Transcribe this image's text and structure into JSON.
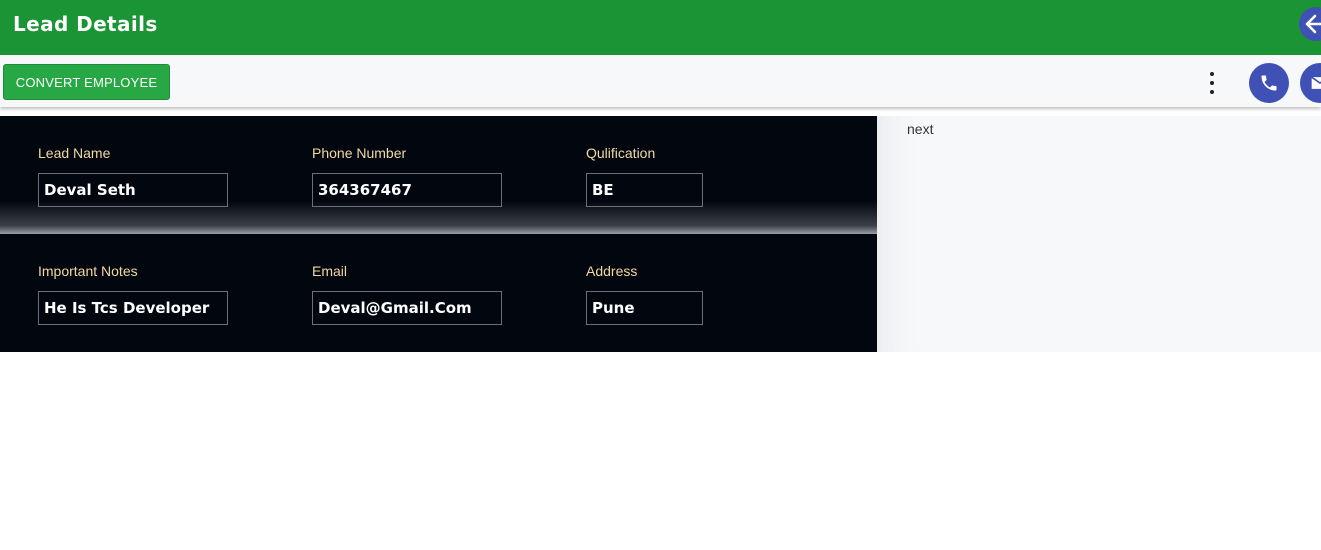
{
  "header": {
    "title": "Lead Details",
    "back_icon": "arrow-left-icon"
  },
  "toolbar": {
    "convert_label": "CONVERT EMPLOYEE",
    "more_icon": "more-vertical-icon",
    "phone_icon": "phone-icon",
    "mail_icon": "mail-icon"
  },
  "fields": {
    "lead_name": {
      "label": "Lead Name",
      "value": "Deval Seth"
    },
    "phone_number": {
      "label": "Phone Number",
      "value": "364367467"
    },
    "qualification": {
      "label": "Qulification",
      "value": "BE"
    },
    "important_notes": {
      "label": "Important Notes",
      "value": "He Is Tcs Developer"
    },
    "email": {
      "label": "Email",
      "value": "Deval@Gmail.Com"
    },
    "address": {
      "label": "Address",
      "value": "Pune"
    }
  },
  "side": {
    "next_label": "next"
  },
  "colors": {
    "header": "#1a9434",
    "button_green": "#28a745",
    "accent_blue": "#3f51b5",
    "panel_dark": "#02070f",
    "label_gold": "#f3d8a2"
  }
}
